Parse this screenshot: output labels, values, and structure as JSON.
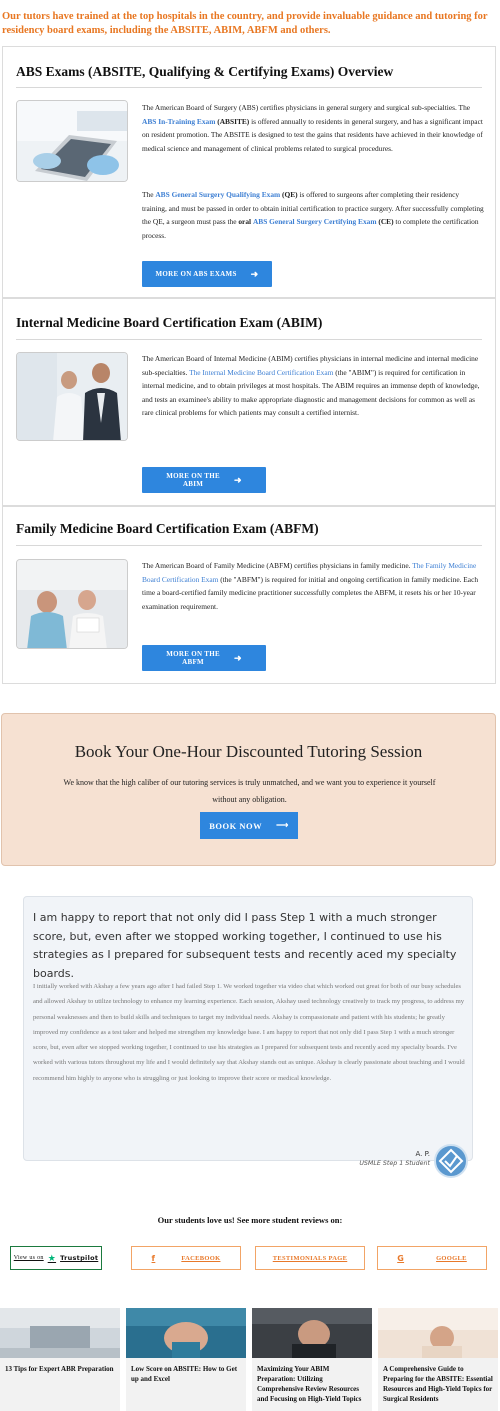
{
  "intro": "Our tutors have trained at the top hospitals in the country, and provide invaluable guidance and tutoring for residency board exams, including the ABSITE, ABIM, ABFM and others.",
  "abs": {
    "title": "ABS Exams (ABSITE, Qualifying & Certifying Exams) Overview",
    "p1_a": "The American Board of Surgery (ABS) certifies physicians in general surgery and surgical sub-specialties. The ",
    "p1_link": "ABS In-Training Exam",
    "p1_b": " (ABSITE)",
    "p1_c": " is offered annually to residents in general surgery, and has a significant impact on resident promotion. The ABSITE is designed to test the gains that residents have achieved in their knowledge of medical science and management of clinical problems related to surgical procedures.",
    "p2_a": "The ",
    "p2_link": "ABS General Surgery Qualifying Exam",
    "p2_b": " (QE)",
    "p2_c": " is offered to surgeons after completing their residency training, and must be passed in order to obtain initial certification to practice surgery. After successfully completing the QE, a surgeon must pass the ",
    "p2_oral": "oral",
    "p2_link2": "ABS General Surgery Certifying Exam",
    "p2_d": " (CE)",
    "p2_e": " to complete the certification process.",
    "button": "MORE ON ABS EXAMS"
  },
  "abim": {
    "title": "Internal Medicine Board Certification Exam (ABIM)",
    "p_a": "The American Board of Internal Medicine (ABIM) certifies physicians in internal medicine and internal medicine sub-specialties. ",
    "p_link": "The Internal Medicine Board Certification Exam",
    "p_b": " (the \"ABIM\") is required for certification in internal medicine, and to obtain privileges at most hospitals. The ABIM requires an immense depth of knowledge, and tests an examinee's ability to make appropriate diagnostic and management decisions for common as well as rare clinical problems for which patients may consult a certified internist.",
    "button_line1": "MORE ON THE",
    "button_line2": "ABIM"
  },
  "abfm": {
    "title": "Family Medicine Board Certification Exam (ABFM)",
    "p_a": "The American Board of Family Medicine (ABFM) certifies physicians in family medicine. ",
    "p_link": "The Family Medicine Board Certification Exam",
    "p_b": " (the \"ABFM\") is required for initial and ongoing certification in family medicine. Each time a board-certified family medicine practitioner successfully completes the ABFM, it resets his or her 10-year examination requirement.",
    "button_line1": "MORE ON THE",
    "button_line2": "ABFM"
  },
  "cta": {
    "title": "Book Your One-Hour Discounted Tutoring Session",
    "text": "We know that the high caliber of our tutoring services is truly unmatched, and we want you to experience it yourself without any obligation.",
    "button": "BOOK NOW"
  },
  "testimonial": {
    "quote": "I am happy to report that not only did I pass Step 1 with a much stronger score, but, even after we stopped working together, I continued to use his strategies as I prepared for subsequent tests and recently aced my specialty boards.",
    "body": "I initially worked with Akshay a few years ago after I had failed Step 1. We worked together via video chat which worked out great for both of our busy schedules and allowed Akshay to utilize technology to enhance my learning experience. Each session, Akshay used technology creatively to track my progress, to address my personal weaknesses and then to build skills and techniques to target my individual needs. Akshay is compassionate and patient with his students; he greatly improved my confidence as a test taker and helped me strengthen my knowledge base. I am happy to report that not only did I pass Step 1 with a much stronger score, but, even after we stopped working together, I continued to use his strategies as I prepared for subsequent tests and recently aced my specialty boards. I've worked with various tutors throughout my life and I would definitely say that Akshay stands out as unique. Akshay is clearly passionate about teaching and I would recommend him highly to anyone who is struggling or just looking to improve their score or medical knowledge.",
    "author": "A. P.",
    "role": "USMLE Step 1 Student"
  },
  "reviews": {
    "heading": "Our students love us! See more student reviews on:",
    "trustpilot_prefix": "View us on",
    "trustpilot_name": "Trustpilot",
    "facebook": "FACEBOOK",
    "testimonials": "TESTIMONIALS PAGE",
    "google": "GOOGLE"
  },
  "articles": [
    {
      "title": "13 Tips for Expert ABR Preparation"
    },
    {
      "title": "Low Score on ABSITE: How to Get up and Excel"
    },
    {
      "title": "Maximizing Your ABIM Preparation: Utilizing Comprehensive Review Resources and Focusing on High-Yield Topics"
    },
    {
      "title": "A Comprehensive Guide to Preparing for the ABSITE: Essential Resources and High-Yield Topics for Surgical Residents"
    }
  ],
  "colors": {
    "accent": "#e87722",
    "button": "#2e86de",
    "link": "#3d7fd3",
    "cta_bg": "#f6e1d2"
  }
}
